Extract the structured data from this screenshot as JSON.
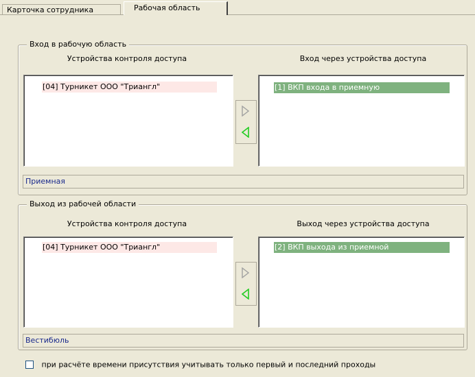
{
  "tabs": [
    {
      "label": "Карточка сотрудника",
      "active": false
    },
    {
      "label": "Рабочая область",
      "active": true
    }
  ],
  "entry": {
    "title": "Вход в рабочую область",
    "left_header": "Устройства контроля доступа",
    "right_header": "Вход через устройства доступа",
    "left_items": [
      "[04] Турникет ООО \"Триангл\""
    ],
    "right_items": [
      "[1] ВКП входа в приемную"
    ],
    "location": "Приемная",
    "add_icon": "arrow-right-icon",
    "remove_icon": "arrow-left-icon"
  },
  "exit": {
    "title": "Выход из рабочей области",
    "left_header": "Устройства контроля доступа",
    "right_header": "Выход через устройства доступа",
    "left_items": [
      "[04] Турникет ООО \"Триангл\""
    ],
    "right_items": [
      "[2] ВКП выхода из приемной"
    ],
    "location": "Вестибюль",
    "add_icon": "arrow-right-icon",
    "remove_icon": "arrow-left-icon"
  },
  "option": {
    "label": "при расчёте времени присутствия учитывать только первый и последний проходы",
    "checked": false
  },
  "colors": {
    "selected_item": "#7fb27f",
    "available_item": "#fde8e6",
    "location_text": "#1a2a8c",
    "arrow_active": "#22cc22",
    "arrow_disabled": "#a0a0a0"
  }
}
